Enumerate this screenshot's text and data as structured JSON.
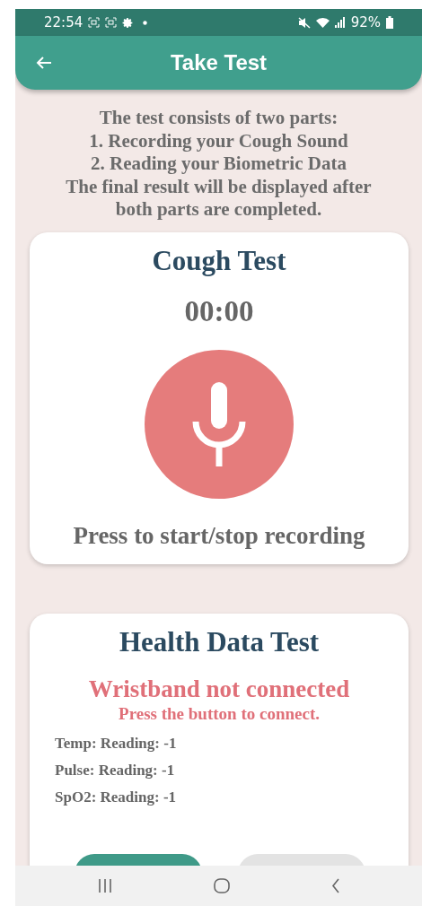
{
  "status_bar": {
    "time": "22:54",
    "battery": "92%"
  },
  "app_bar": {
    "title": "Take Test"
  },
  "intro": "The test consists of two parts:\n1. Recording your Cough Sound\n2. Reading your Biometric Data\nThe final result will be displayed after\nboth parts are completed.",
  "cough_test": {
    "title": "Cough Test",
    "timer": "00:00",
    "instruction": "Press to start/stop recording"
  },
  "health_test": {
    "title": "Health Data Test",
    "status": "Wristband not connected",
    "hint": "Press the button to connect.",
    "readings": [
      "Temp: Reading: -1",
      "Pulse: Reading: -1",
      "SpO2: Reading: -1"
    ],
    "buttons": [
      {
        "kind": "primary"
      },
      {
        "kind": "secondary"
      }
    ]
  }
}
